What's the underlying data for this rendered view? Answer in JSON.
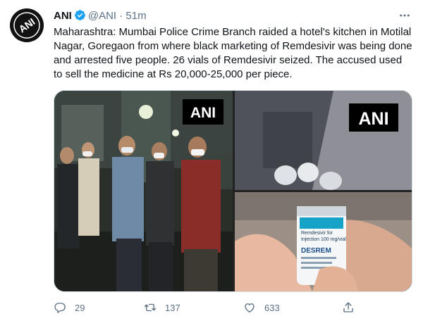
{
  "account": {
    "name": "ANI",
    "handle": "@ANI",
    "separator": "·",
    "time": "51m",
    "avatar_text": "ANI"
  },
  "tweet": {
    "text": "Maharashtra: Mumbai Police Crime Branch raided a hotel's kitchen in Motilal Nagar, Goregaon from where black marketing of Remdesivir was being done and arrested five people. 26 vials of Remdesivir seized. The accused used to sell the medicine at Rs 20,000-25,000 per piece."
  },
  "media": {
    "watermark": "ANI",
    "vial": {
      "brand": "DESREM",
      "drug_line_1": "Remdesivir for",
      "drug_line_2": "Injection 100 mg/vial"
    }
  },
  "actions": {
    "replies": "29",
    "retweets": "137",
    "likes": "633"
  },
  "colors": {
    "secondary_text": "#5b7083",
    "verified_blue": "#1da1f2",
    "border": "#cfd9de"
  },
  "icons": [
    "verified-icon",
    "more-icon",
    "reply-icon",
    "retweet-icon",
    "like-icon",
    "share-icon"
  ]
}
